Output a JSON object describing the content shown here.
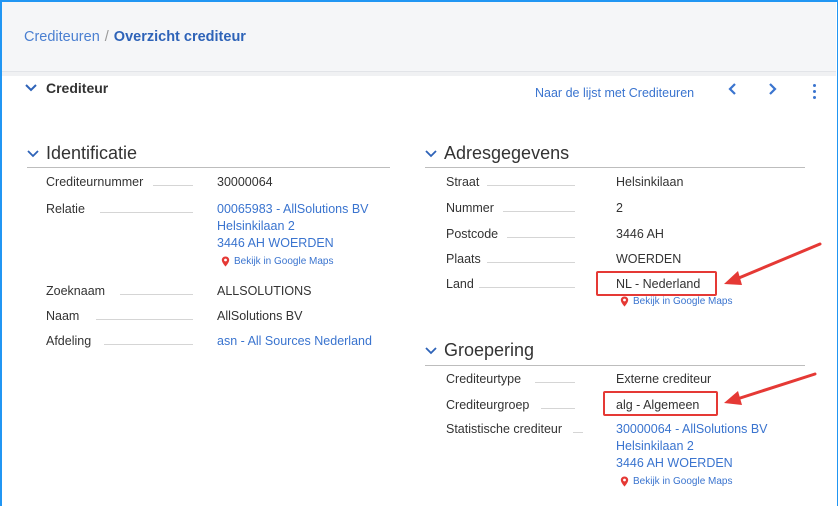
{
  "breadcrumb": {
    "parent": "Crediteuren",
    "separator": "/",
    "current": "Overzicht crediteur"
  },
  "section": {
    "title": "Crediteur",
    "list_link": "Naar de lijst met Crediteuren"
  },
  "identificatie": {
    "title": "Identificatie",
    "crediteurnummer": {
      "label": "Crediteurnummer",
      "value": "30000064"
    },
    "relatie": {
      "label": "Relatie",
      "line1": "00065983 - AllSolutions BV",
      "line2": "Helsinkilaan 2",
      "line3": "3446 AH WOERDEN",
      "maps": "Bekijk in Google Maps"
    },
    "zoeknaam": {
      "label": "Zoeknaam",
      "value": "ALLSOLUTIONS"
    },
    "naam": {
      "label": "Naam",
      "value": "AllSolutions BV"
    },
    "afdeling": {
      "label": "Afdeling",
      "value": "asn - All Sources Nederland"
    }
  },
  "adres": {
    "title": "Adresgegevens",
    "straat": {
      "label": "Straat",
      "value": "Helsinkilaan"
    },
    "nummer": {
      "label": "Nummer",
      "value": "2"
    },
    "postcode": {
      "label": "Postcode",
      "value": "3446 AH"
    },
    "plaats": {
      "label": "Plaats",
      "value": "WOERDEN"
    },
    "land": {
      "label": "Land",
      "value": "NL - Nederland",
      "maps": "Bekijk in Google Maps"
    }
  },
  "groepering": {
    "title": "Groepering",
    "crediteurtype": {
      "label": "Crediteurtype",
      "value": "Externe crediteur"
    },
    "crediteurgroep": {
      "label": "Crediteurgroep",
      "value": "alg - Algemeen"
    },
    "statistisch": {
      "label": "Statistische crediteur",
      "line1": "30000064 - AllSolutions BV",
      "line2": "Helsinkilaan 2",
      "line3": "3446 AH WOERDEN",
      "maps": "Bekijk in Google Maps"
    }
  },
  "colors": {
    "accent": "#3a74cf",
    "highlight": "#e53935",
    "pin": "#e53935"
  },
  "icons": [
    "chevron-down-icon",
    "chevron-left-icon",
    "chevron-right-icon",
    "more-vert-icon",
    "map-pin-icon",
    "arrow-annotation"
  ]
}
